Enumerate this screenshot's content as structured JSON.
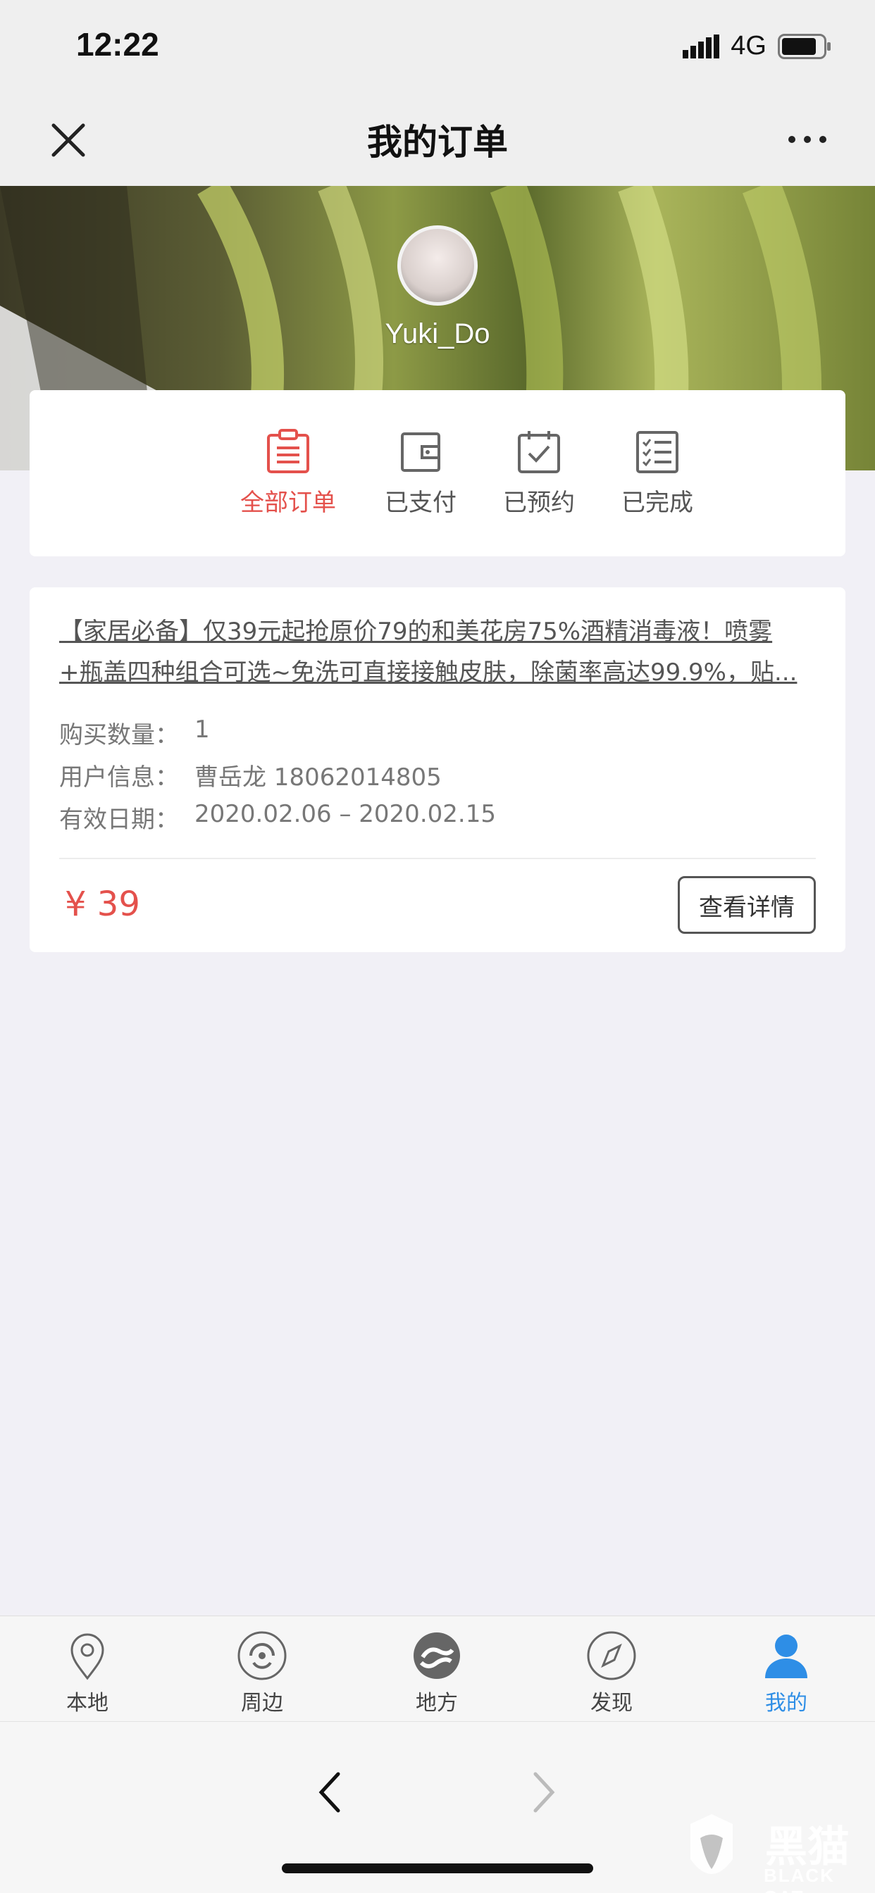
{
  "status": {
    "time": "12:22",
    "network": "4G"
  },
  "nav": {
    "title": "我的订单"
  },
  "profile": {
    "username": "Yuki_Do"
  },
  "order_tabs": [
    {
      "label": "全部订单",
      "icon": "clipboard-icon",
      "active": true
    },
    {
      "label": "已支付",
      "icon": "wallet-icon",
      "active": false
    },
    {
      "label": "已预约",
      "icon": "calendar-check-icon",
      "active": false
    },
    {
      "label": "已完成",
      "icon": "checklist-icon",
      "active": false
    }
  ],
  "order": {
    "title_line1": "【家居必备】仅39元起抢原价79的和美花房75%酒精消毒液！喷雾",
    "title_line2": "+瓶盖四种组合可选~免洗可直接接触皮肤，除菌率高达99.9%，贴...",
    "quantity_label": "购买数量：",
    "quantity": "1",
    "user_label": "用户信息：",
    "user": "曹岳龙 18062014805",
    "date_label": "有效日期：",
    "date": "2020.02.06 – 2020.02.15",
    "price": "¥ 39",
    "detail_button": "查看详情"
  },
  "bottom_tabs": [
    {
      "label": "本地",
      "icon": "location-pin-icon",
      "active": false
    },
    {
      "label": "周边",
      "icon": "radar-icon",
      "active": false
    },
    {
      "label": "地方",
      "icon": "swirl-icon",
      "active": false
    },
    {
      "label": "发现",
      "icon": "compass-icon",
      "active": false
    },
    {
      "label": "我的",
      "icon": "user-icon",
      "active": true
    }
  ],
  "watermark": {
    "text": "黑猫",
    "sub": "BLACK CAT"
  },
  "colors": {
    "accent_red": "#e4514c",
    "accent_blue": "#2e8ee6"
  }
}
